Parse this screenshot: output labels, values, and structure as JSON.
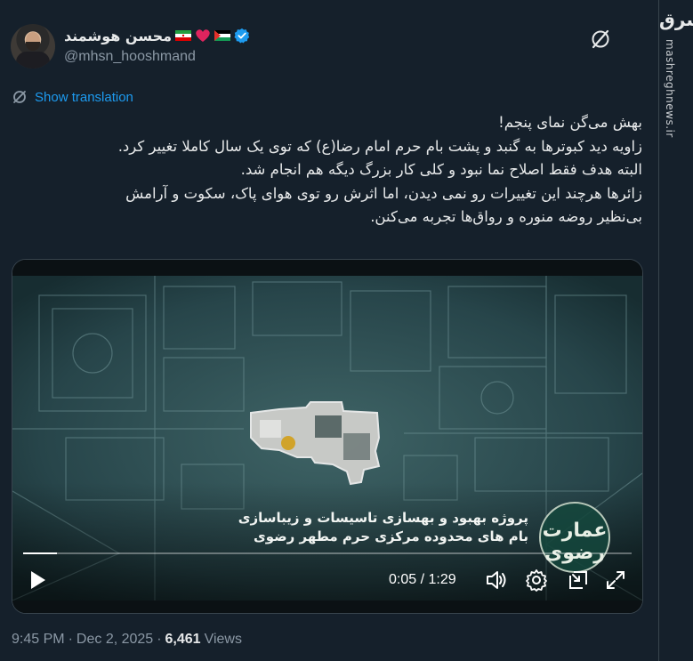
{
  "author": {
    "display_name": "محسن هوشمند",
    "handle": "@mhsn_hooshmand",
    "badges": [
      "palestine-flag-icon",
      "red-heart-icon",
      "iran-flag-icon",
      "verified-badge-icon"
    ]
  },
  "translation": {
    "label": "Show translation"
  },
  "tweet": {
    "lines": [
      "بهش می‌گن نمای پنجم!",
      "زاویه دید کبوترها به گنبد و پشت بام حرم امام رضا(ع) که توی یک سال کاملا تغییر کرد.",
      "البته هدف فقط اصلاح نما نبود و کلی کار بزرگ دیگه هم انجام شد.",
      "زائرها هرچند این تغییرات رو نمی دیدن، اما اثرش رو توی هوای پاک، سکوت و آرامش",
      "بی‌نظیر روضه منوره و رواق‌ها تجربه می‌کنن."
    ]
  },
  "video": {
    "caption_line1": "پروژه بهبود و بهسازی تاسیسات و زیباسازی",
    "caption_line2": "بام های محدوده مرکزی حرم مطهر رضوی",
    "seal_text": "عمارت رضوی",
    "current_time": "0:05",
    "duration": "1:29",
    "time_display": "0:05 / 1:29",
    "progress_fraction": 0.056
  },
  "meta": {
    "time": "9:45 PM",
    "date": "Dec 2, 2025",
    "views_count": "6,461",
    "views_label": "Views"
  },
  "site": {
    "logo_text": "مشرق",
    "watermark": "mashreghnews.ir"
  },
  "colors": {
    "background": "#15202b",
    "accent": "#1d9bf0",
    "text": "#e7e9ea",
    "muted": "#8b98a5"
  }
}
